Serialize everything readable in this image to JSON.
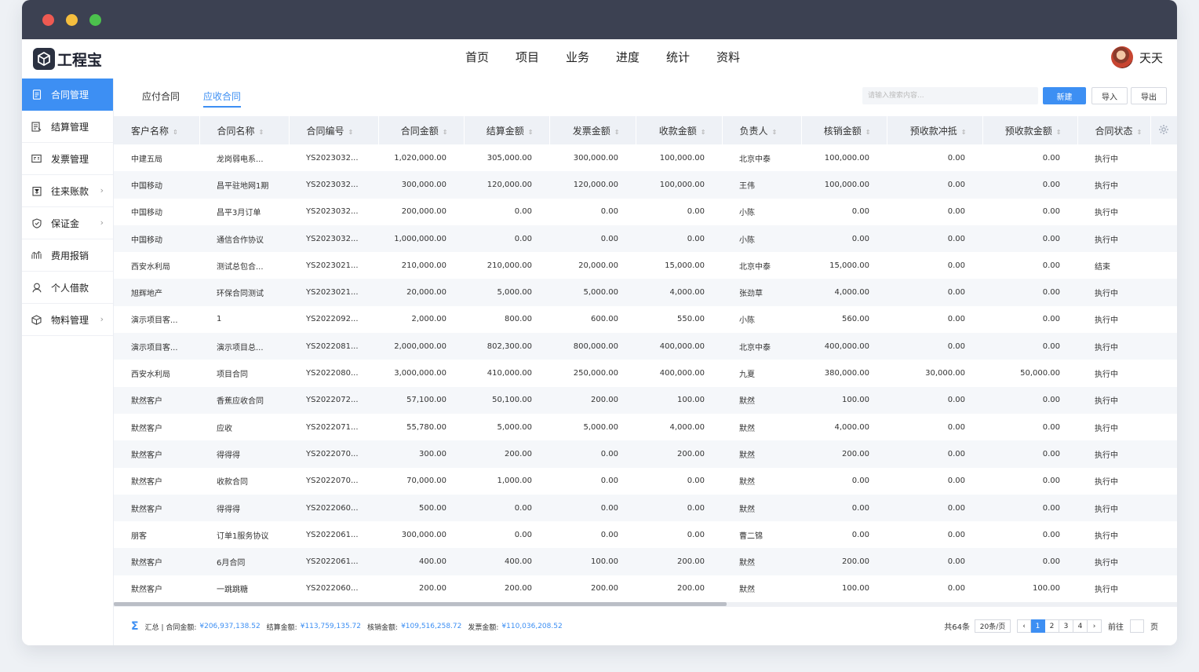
{
  "app": {
    "logo_text": "工程宝",
    "user_name": "天天"
  },
  "topnav": [
    "首页",
    "项目",
    "业务",
    "进度",
    "统计",
    "资料"
  ],
  "sidebar": [
    {
      "label": "合同管理",
      "icon": "document-icon",
      "active": true,
      "arrow": false
    },
    {
      "label": "结算管理",
      "icon": "settlement-icon",
      "active": false,
      "arrow": false
    },
    {
      "label": "发票管理",
      "icon": "invoice-icon",
      "active": false,
      "arrow": false
    },
    {
      "label": "往来账款",
      "icon": "ledger-icon",
      "active": false,
      "arrow": true
    },
    {
      "label": "保证金",
      "icon": "shield-icon",
      "active": false,
      "arrow": true
    },
    {
      "label": "费用报销",
      "icon": "chart-icon",
      "active": false,
      "arrow": false
    },
    {
      "label": "个人借款",
      "icon": "person-icon",
      "active": false,
      "arrow": false
    },
    {
      "label": "物料管理",
      "icon": "box-icon",
      "active": false,
      "arrow": true
    }
  ],
  "tabs": [
    {
      "label": "应付合同",
      "active": false
    },
    {
      "label": "应收合同",
      "active": true
    }
  ],
  "search": {
    "placeholder": "请输入搜索内容..."
  },
  "toolbar": {
    "new_label": "新建",
    "import_label": "导入",
    "export_label": "导出"
  },
  "table": {
    "columns": [
      {
        "label": "客户名称",
        "num": false,
        "width": 109
      },
      {
        "label": "合同名称",
        "num": false,
        "width": 114
      },
      {
        "label": "合同编号",
        "num": false,
        "width": 114
      },
      {
        "label": "合同金额",
        "num": true,
        "width": 109
      },
      {
        "label": "结算金额",
        "num": true,
        "width": 109
      },
      {
        "label": "发票金额",
        "num": true,
        "width": 110
      },
      {
        "label": "收款金额",
        "num": true,
        "width": 110
      },
      {
        "label": "负责人",
        "num": false,
        "width": 101
      },
      {
        "label": "核销金额",
        "num": true,
        "width": 109
      },
      {
        "label": "预收款冲抵",
        "num": true,
        "width": 122
      },
      {
        "label": "预收款金额",
        "num": true,
        "width": 121
      },
      {
        "label": "合同状态",
        "num": false,
        "width": 93
      }
    ],
    "rows": [
      [
        "中建五局",
        "龙岗弱电系...",
        "YS2023032...",
        "1,020,000.00",
        "305,000.00",
        "300,000.00",
        "100,000.00",
        "北京中泰",
        "100,000.00",
        "0.00",
        "0.00",
        "执行中"
      ],
      [
        "中国移动",
        "昌平驻地网1期",
        "YS2023032...",
        "300,000.00",
        "120,000.00",
        "120,000.00",
        "100,000.00",
        "王伟",
        "100,000.00",
        "0.00",
        "0.00",
        "执行中"
      ],
      [
        "中国移动",
        "昌平3月订单",
        "YS2023032...",
        "200,000.00",
        "0.00",
        "0.00",
        "0.00",
        "小陈",
        "0.00",
        "0.00",
        "0.00",
        "执行中"
      ],
      [
        "中国移动",
        "通信合作协议",
        "YS2023032...",
        "1,000,000.00",
        "0.00",
        "0.00",
        "0.00",
        "小陈",
        "0.00",
        "0.00",
        "0.00",
        "执行中"
      ],
      [
        "西安水利局",
        "测试总包合...",
        "YS2023021...",
        "210,000.00",
        "210,000.00",
        "20,000.00",
        "15,000.00",
        "北京中泰",
        "15,000.00",
        "0.00",
        "0.00",
        "结束"
      ],
      [
        "旭辉地产",
        "环保合同测试",
        "YS2023021...",
        "20,000.00",
        "5,000.00",
        "5,000.00",
        "4,000.00",
        "张劲草",
        "4,000.00",
        "0.00",
        "0.00",
        "执行中"
      ],
      [
        "演示项目客...",
        "1",
        "YS2022092...",
        "2,000.00",
        "800.00",
        "600.00",
        "550.00",
        "小陈",
        "560.00",
        "0.00",
        "0.00",
        "执行中"
      ],
      [
        "演示项目客...",
        "演示项目总...",
        "YS2022081...",
        "2,000,000.00",
        "802,300.00",
        "800,000.00",
        "400,000.00",
        "北京中泰",
        "400,000.00",
        "0.00",
        "0.00",
        "执行中"
      ],
      [
        "西安水利局",
        "项目合同",
        "YS2022080...",
        "3,000,000.00",
        "410,000.00",
        "250,000.00",
        "400,000.00",
        "九夏",
        "380,000.00",
        "30,000.00",
        "50,000.00",
        "执行中"
      ],
      [
        "默然客户",
        "香蕉应收合同",
        "YS2022072...",
        "57,100.00",
        "50,100.00",
        "200.00",
        "100.00",
        "默然",
        "100.00",
        "0.00",
        "0.00",
        "执行中"
      ],
      [
        "默然客户",
        "应收",
        "YS2022071...",
        "55,780.00",
        "5,000.00",
        "5,000.00",
        "4,000.00",
        "默然",
        "4,000.00",
        "0.00",
        "0.00",
        "执行中"
      ],
      [
        "默然客户",
        "得得得",
        "YS2022070...",
        "300.00",
        "200.00",
        "0.00",
        "200.00",
        "默然",
        "200.00",
        "0.00",
        "0.00",
        "执行中"
      ],
      [
        "默然客户",
        "收款合同",
        "YS2022070...",
        "70,000.00",
        "1,000.00",
        "0.00",
        "0.00",
        "默然",
        "0.00",
        "0.00",
        "0.00",
        "执行中"
      ],
      [
        "默然客户",
        "得得得",
        "YS2022060...",
        "500.00",
        "0.00",
        "0.00",
        "0.00",
        "默然",
        "0.00",
        "0.00",
        "0.00",
        "执行中"
      ],
      [
        "朋客",
        "订单1服务协议",
        "YS2022061...",
        "300,000.00",
        "0.00",
        "0.00",
        "0.00",
        "曹二锦",
        "0.00",
        "0.00",
        "0.00",
        "执行中"
      ],
      [
        "默然客户",
        "6月合同",
        "YS2022061...",
        "400.00",
        "400.00",
        "100.00",
        "200.00",
        "默然",
        "200.00",
        "0.00",
        "0.00",
        "执行中"
      ],
      [
        "默然客户",
        "一跳跳糖",
        "YS2022060...",
        "200.00",
        "200.00",
        "200.00",
        "200.00",
        "默然",
        "100.00",
        "0.00",
        "100.00",
        "执行中"
      ]
    ]
  },
  "summary": {
    "label": "汇总 | 合同金额:",
    "contract_amount": "¥206,937,138.52",
    "settle_label": "结算金额:",
    "settle_amount": "¥113,759,135.72",
    "writeoff_label": "核销金额:",
    "writeoff_amount": "¥109,516,258.72",
    "invoice_label": "发票金额:",
    "invoice_amount": "¥110,036,208.52"
  },
  "pagination": {
    "total": "共64条",
    "page_size": "20条/页",
    "pages": [
      "1",
      "2",
      "3",
      "4"
    ],
    "current": "1",
    "prev": "‹",
    "next": "›",
    "goto_label": "前往",
    "page_suffix": "页"
  }
}
